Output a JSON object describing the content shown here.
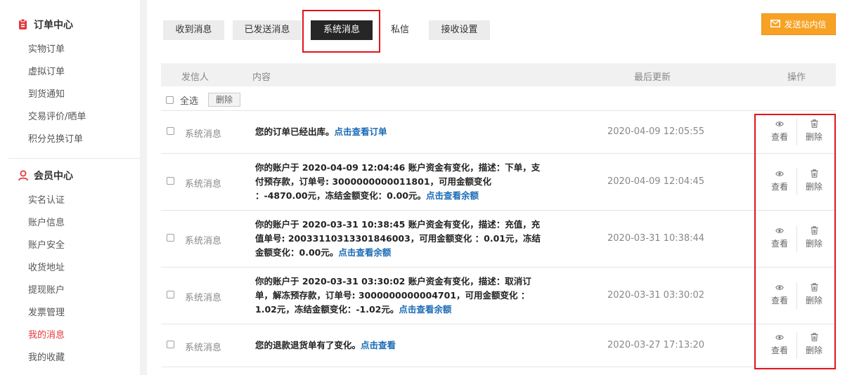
{
  "sidebar": {
    "order_center": {
      "title": "订单中心",
      "items": [
        "实物订单",
        "虚拟订单",
        "到货通知",
        "交易评价/晒单",
        "积分兑换订单"
      ]
    },
    "member_center": {
      "title": "会员中心",
      "items": [
        "实名认证",
        "账户信息",
        "账户安全",
        "收货地址",
        "提现账户",
        "发票管理",
        "我的消息",
        "我的收藏"
      ],
      "active_item": "我的消息"
    }
  },
  "tabs": [
    "收到消息",
    "已发送消息",
    "系统消息",
    "私信",
    "接收设置"
  ],
  "active_tab": "系统消息",
  "send_button": "发送站内信",
  "table": {
    "headers": {
      "sender": "发信人",
      "content": "内容",
      "updated": "最后更新",
      "action": "操作"
    },
    "select_all": "全选",
    "delete_button": "删除",
    "rows": [
      {
        "sender": "系统消息",
        "text": "您的订单已经出库。",
        "link": "点击查看订单",
        "time": "2020-04-09 12:05:55",
        "view": "查看",
        "delete": "删除"
      },
      {
        "sender": "系统消息",
        "text": "你的账户于 2020-04-09 12:04:46 账户资金有变化，描述：下单，支付预存款，订单号: 3000000000011801，可用金额变化 ：-4870.00元，冻结金额变化：0.00元。",
        "link": "点击查看余额",
        "time": "2020-04-09 12:04:45",
        "view": "查看",
        "delete": "删除"
      },
      {
        "sender": "系统消息",
        "text": "你的账户于 2020-03-31 10:38:45 账户资金有变化，描述：充值，充值单号: 200331103133018460​03，可用金额变化 ：0.01元，冻结金额变化：0.00元。",
        "link": "点击查看余额",
        "time": "2020-03-31 10:38:44",
        "view": "查看",
        "delete": "删除"
      },
      {
        "sender": "系统消息",
        "text": "你的账户于 2020-03-31 03:30:02 账户资金有变化，描述：取消订单，解冻预存款，订单号: 3000000000004701，可用金额变化 ：1.02元，冻结金额变化：-1.02元。",
        "link": "点击查看余额",
        "time": "2020-03-31 03:30:02",
        "view": "查看",
        "delete": "删除"
      },
      {
        "sender": "系统消息",
        "text": "您的退款退货单有了变化。",
        "link": "点击查看",
        "time": "2020-03-27 17:13:20",
        "view": "查看",
        "delete": "删除"
      }
    ]
  },
  "colors": {
    "accent_red": "#e4393c",
    "highlight_box": "#e4131a",
    "send_button": "#f7a224",
    "link": "#1a6bb5",
    "active_tab": "#262626"
  },
  "icons": [
    "order-icon",
    "member-icon",
    "envelope-icon",
    "eye-icon",
    "trash-icon"
  ]
}
